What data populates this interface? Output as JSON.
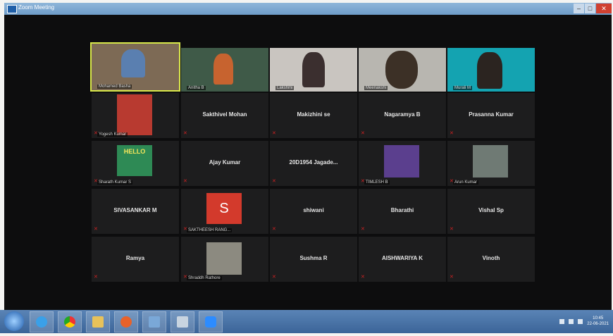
{
  "window": {
    "title": "Zoom Meeting"
  },
  "colors": {
    "active_speaker_border": "#d8e84a",
    "zoom_blue": "#2d8cff",
    "mic_muted": "#cc2222"
  },
  "participants": {
    "p1": "Mohamed Basha",
    "p2": "Anitha B",
    "p3": "Lakshmi",
    "p4": "Meenakshi",
    "p5": "Murali M",
    "p6": "Yogesh Kumar",
    "p7": "Sakthivel Mohan",
    "p8": "Makizhini se",
    "p9": "Nagaramya B",
    "p10": "Prasanna Kumar",
    "p11": "Sharath Kumar S",
    "p12": "Ajay Kumar",
    "p13": "20D1954 Jagade...",
    "p14": "TIMLESH B",
    "p15": "Arun Kumar",
    "p16": "SIVASANKAR M",
    "p17": "SAKTHEESH RANG...",
    "p18": "shiwani",
    "p19": "Bharathi",
    "p20": "Vishal Sp",
    "p21": "Ramya",
    "p22": "Shraddh Rathore",
    "p23": "Sushma R",
    "p24": "AISHWARIYA K",
    "p25": "Vinoth"
  },
  "avatars": {
    "s_letter": "S",
    "s_color": "#d33a2c",
    "hello_text": "HELLO"
  },
  "taskbar": {
    "clock_time": "10:45",
    "clock_date": "22-06-2021"
  }
}
